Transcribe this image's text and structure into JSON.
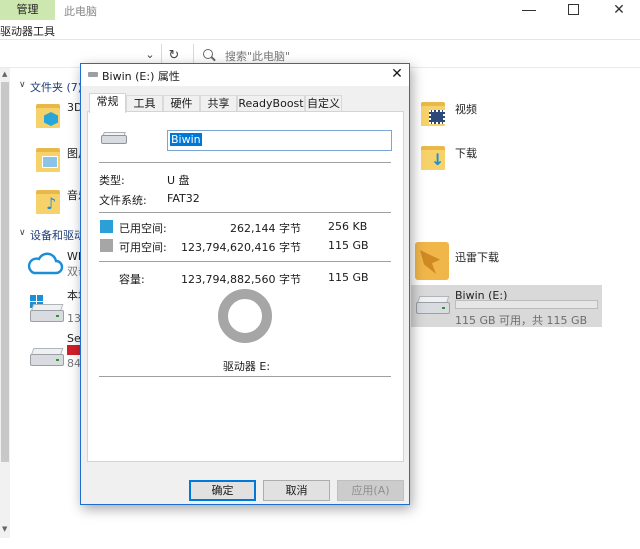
{
  "explorer": {
    "ribbon_tab": "管理",
    "title": "此电脑",
    "ribbon_subtab": "驱动器工具",
    "search_placeholder": "搜索\"此电脑\"",
    "sections": {
      "folders": "文件夹 (7)",
      "devices": "设备和驱动器"
    },
    "folders_left": [
      {
        "label": "3D"
      },
      {
        "label": "图片"
      },
      {
        "label": "音乐"
      }
    ],
    "folders_right": [
      {
        "label": "视频"
      },
      {
        "label": "下载"
      }
    ],
    "devices_left": [
      {
        "label": "WP",
        "sub": "双击"
      },
      {
        "label": "本地",
        "sub": "138"
      },
      {
        "label": "Sea",
        "sub": "84."
      }
    ],
    "xunlei_label": "迅雷下载",
    "drive_e": {
      "label": "Biwin (E:)",
      "sub": "115 GB 可用，共 115 GB",
      "used_fraction": 0.0
    }
  },
  "dialog": {
    "title": "Biwin (E:) 属性",
    "tabs": [
      "常规",
      "工具",
      "硬件",
      "共享",
      "ReadyBoost",
      "自定义"
    ],
    "active_tab": "常规",
    "volume_name": "Biwin",
    "type_label": "类型:",
    "type_value": "U 盘",
    "fs_label": "文件系统:",
    "fs_value": "FAT32",
    "used_label": "已用空间:",
    "used_bytes": "262,144 字节",
    "used_size": "256 KB",
    "free_label": "可用空间:",
    "free_bytes": "123,794,620,416 字节",
    "free_size": "115 GB",
    "capacity_label": "容量:",
    "capacity_bytes": "123,794,882,560 字节",
    "capacity_size": "115 GB",
    "drive_letter": "驱动器 E:",
    "buttons": {
      "ok": "确定",
      "cancel": "取消",
      "apply": "应用(A)"
    },
    "colors": {
      "used": "#2a9fd8",
      "free": "#a6a6a6",
      "accent": "#0078d7"
    }
  }
}
